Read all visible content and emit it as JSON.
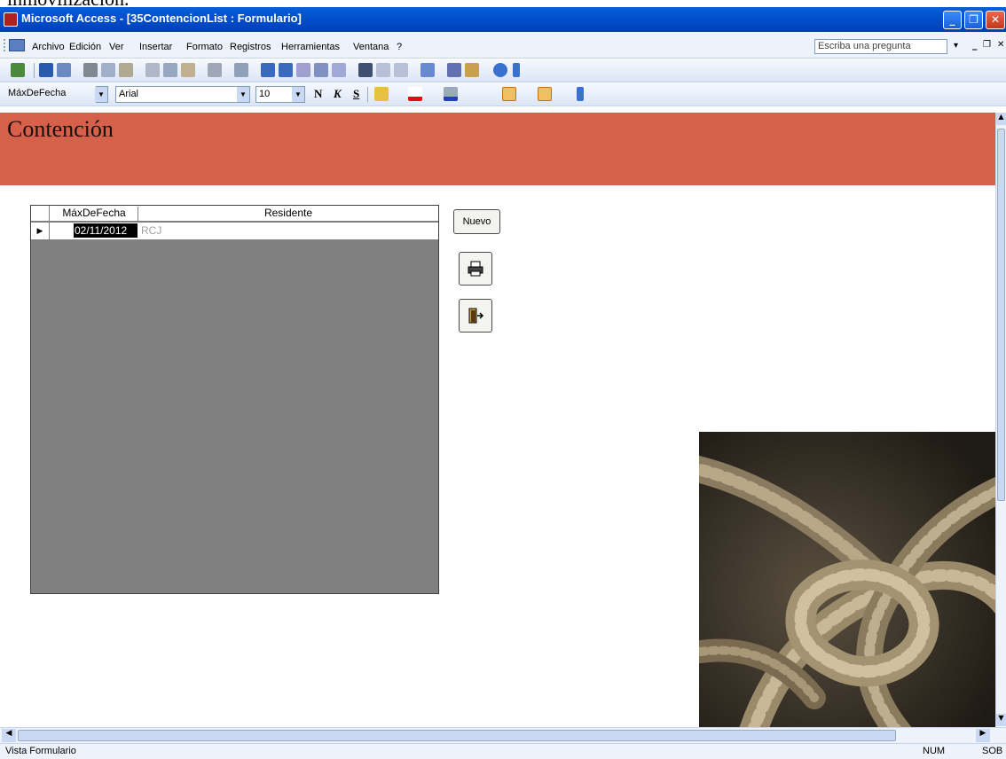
{
  "caption_top": "inmovilización.",
  "window": {
    "title": "Microsoft Access - [35ContencionList : Formulario]"
  },
  "menu": {
    "items": [
      "Archivo",
      "Edición",
      "Ver",
      "Insertar",
      "Formato",
      "Registros",
      "Herramientas",
      "Ventana",
      "?"
    ],
    "ask_placeholder": "Escriba una pregunta"
  },
  "format_bar": {
    "control": "MáxDeFecha",
    "font": "Arial",
    "size": "10",
    "bold": "N",
    "italic": "K",
    "underline": "S"
  },
  "form": {
    "title": "Contención",
    "columns": [
      "MáxDeFecha",
      "Residente"
    ],
    "rows": [
      {
        "fecha": "02/11/2012",
        "residente": "RCJ"
      }
    ],
    "new_button": "Nuevo",
    "print_icon": "printer-icon",
    "exit_icon": "exit-door-icon",
    "image": "rope-knot-photo"
  },
  "status": {
    "left": "Vista Formulario",
    "num": "NUM",
    "sob": "SOB"
  },
  "colors": {
    "header": "#d5614a",
    "titlebar": "#0a5fd8",
    "grid_bg": "#808080"
  }
}
